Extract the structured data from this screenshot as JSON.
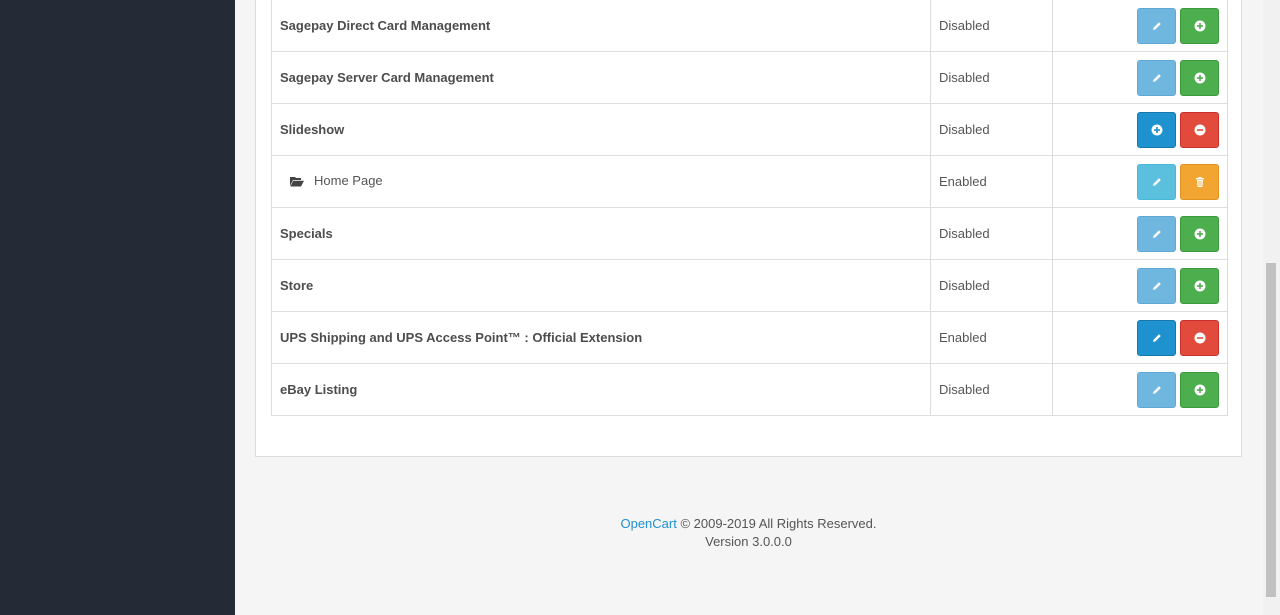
{
  "extensions": [
    {
      "name": "Sagepay Direct Card Management",
      "status": "Disabled",
      "child": false,
      "buttons": [
        "edit-muted",
        "install"
      ]
    },
    {
      "name": "Sagepay Server Card Management",
      "status": "Disabled",
      "child": false,
      "buttons": [
        "edit-muted",
        "install"
      ]
    },
    {
      "name": "Slideshow",
      "status": "Disabled",
      "child": false,
      "buttons": [
        "install-blue",
        "uninstall"
      ]
    },
    {
      "name": "Home Page",
      "status": "Enabled",
      "child": true,
      "buttons": [
        "edit-info",
        "delete"
      ]
    },
    {
      "name": "Specials",
      "status": "Disabled",
      "child": false,
      "buttons": [
        "edit-muted",
        "install"
      ]
    },
    {
      "name": "Store",
      "status": "Disabled",
      "child": false,
      "buttons": [
        "edit-muted",
        "install"
      ]
    },
    {
      "name": "UPS Shipping and UPS Access Point™ : Official Extension",
      "status": "Enabled",
      "child": false,
      "buttons": [
        "edit-primary",
        "uninstall"
      ]
    },
    {
      "name": "eBay Listing",
      "status": "Disabled",
      "child": false,
      "buttons": [
        "edit-muted",
        "install"
      ]
    }
  ],
  "footer": {
    "link_text": "OpenCart",
    "copyright": " © 2009-2019 All Rights Reserved.",
    "version": "Version 3.0.0.0"
  },
  "colors": {
    "sidebar": "#252b36",
    "primary": "#1e91cf",
    "success": "#4cae4c",
    "danger": "#e24b3b",
    "warning": "#f2a531"
  }
}
